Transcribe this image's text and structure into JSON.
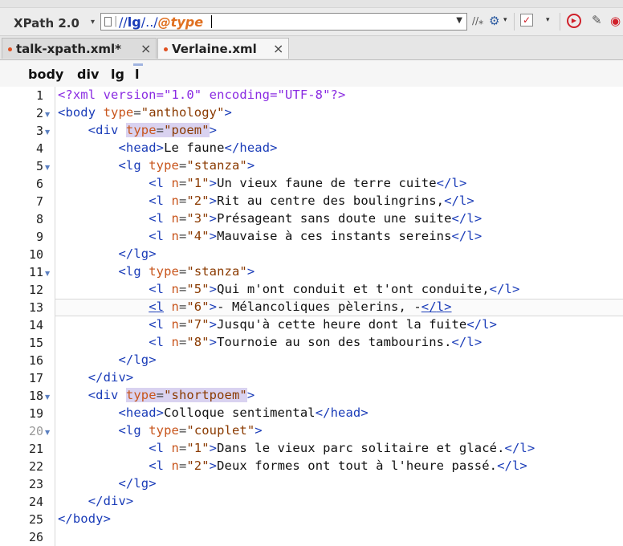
{
  "toolbar": {
    "xpath_label": "XPath 2.0",
    "expression": {
      "part1": "//",
      "part2": "lg",
      "part3": "/../",
      "part4": "@type"
    },
    "colors": {
      "expr_slash": "#1a3cb8",
      "expr_step": "#1a3cb8",
      "expr_attr": "#e07020"
    }
  },
  "tabs": [
    {
      "label": "talk-xpath.xml*"
    },
    {
      "label": "Verlaine.xml"
    }
  ],
  "breadcrumb": [
    "body",
    "div",
    "lg",
    "l"
  ],
  "editor": {
    "lines": [
      {
        "n": "1"
      },
      {
        "n": "2"
      },
      {
        "n": "3"
      },
      {
        "n": "4"
      },
      {
        "n": "5"
      },
      {
        "n": "6"
      },
      {
        "n": "7"
      },
      {
        "n": "8"
      },
      {
        "n": "9"
      },
      {
        "n": "10"
      },
      {
        "n": "11"
      },
      {
        "n": "12"
      },
      {
        "n": "13"
      },
      {
        "n": "14"
      },
      {
        "n": "15"
      },
      {
        "n": "16"
      },
      {
        "n": "17"
      },
      {
        "n": "18"
      },
      {
        "n": "19"
      },
      {
        "n": "20"
      },
      {
        "n": "21"
      },
      {
        "n": "22"
      },
      {
        "n": "23"
      },
      {
        "n": "24"
      },
      {
        "n": "25"
      },
      {
        "n": "26"
      }
    ],
    "code": {
      "l1": "<?xml version=\"1.0\" encoding=\"UTF-8\"?>",
      "body_tag": "body",
      "type_attr": "type",
      "anthology": "\"anthology\"",
      "div_tag": "div",
      "poem": "\"poem\"",
      "shortpoem": "\"shortpoem\"",
      "head_tag": "head",
      "head1": "Le faune",
      "head2": "Colloque sentimental",
      "lg_tag": "lg",
      "stanza": "\"stanza\"",
      "couplet": "\"couplet\"",
      "l_tag": "l",
      "n_attr": "n",
      "v1": "\"1\"",
      "v2": "\"2\"",
      "v3": "\"3\"",
      "v4": "\"4\"",
      "v5": "\"5\"",
      "v6": "\"6\"",
      "v7": "\"7\"",
      "v8": "\"8\"",
      "t1": "Un vieux faune de terre cuite",
      "t2": "Rit au centre des boulingrins,",
      "t3": "Présageant sans doute une suite",
      "t4": "Mauvaise à ces instants sereins",
      "t5": "Qui m'ont conduit et t'ont conduite,",
      "t6": "- Mélancoliques pèlerins, -",
      "t7": "Jusqu'à cette heure dont la fuite",
      "t8": "Tournoie au son des tambourins.",
      "c1": "Dans le vieux parc solitaire et glacé.",
      "c2": "Deux formes ont tout à l'heure passé."
    }
  }
}
